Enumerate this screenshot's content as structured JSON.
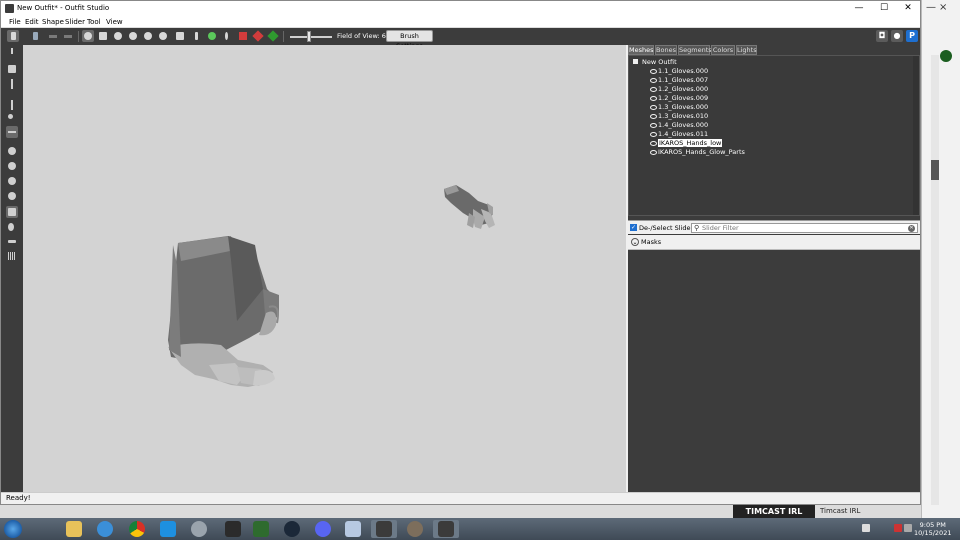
{
  "window": {
    "title": "New Outfit* - Outfit Studio",
    "controls": [
      "—",
      "☐",
      "✕"
    ]
  },
  "menu": [
    "File",
    "Edit",
    "Shape",
    "Slider",
    "Tool",
    "View"
  ],
  "toolbar": {
    "field_of_view_label": "Field of View: 65",
    "brush_settings_label": "Brush Settings",
    "icons": [
      "select-icon",
      "transform-icon",
      "undo-icon",
      "redo-icon",
      "brush-standard-icon",
      "brush-deflate-icon",
      "brush-move-icon",
      "brush-smooth-icon",
      "brush-undiff-icon",
      "brush-weight-icon",
      "brush-color-icon",
      "brush-alpha-icon",
      "eraser-icon",
      "pen-icon",
      "mask-icon",
      "invert-icon",
      "warning-icon",
      "center-icon"
    ],
    "right_icons": [
      "discord-icon",
      "github-icon",
      "patreon-icon"
    ]
  },
  "left_tools": [
    "select-tool-icon",
    "transform-tool-icon",
    "pivot-tool-icon",
    "vertex-tool-icon",
    "mask-brush-icon",
    "inflate-brush-icon",
    "deflate-brush-icon",
    "smooth-brush-icon",
    "move-brush-icon",
    "weight-brush-icon",
    "color-brush-icon",
    "alpha-brush-icon",
    "collision-icon",
    "bone-icon",
    "grid-icon"
  ],
  "tabs": [
    "Meshes",
    "Bones",
    "Segments",
    "Colors",
    "Lights"
  ],
  "mesh_tree": {
    "root": "New Outfit",
    "meshes": [
      "1.1_Gloves.000",
      "1.1_Gloves.007",
      "1.2_Gloves.000",
      "1.2_Gloves.009",
      "1.3_Gloves.000",
      "1.3_Gloves.010",
      "1.4_Gloves.000",
      "1.4_Gloves.011",
      "IKAROS_Hands_low",
      "IKAROS_Hands_Glow_Parts"
    ],
    "selected_index": 8
  },
  "sliders": {
    "deselect_label": "De-/Select Sliders",
    "filter_placeholder": "Slider Filter",
    "masks_label": "Masks"
  },
  "status": {
    "text": "Ready!"
  },
  "taskbar": {
    "apps": [
      "explorer-icon",
      "ie-icon",
      "chrome-icon",
      "app-icon",
      "photos-icon",
      "cursor-icon",
      "terminal-icon",
      "steam-icon",
      "discord-icon",
      "notepad-icon",
      "outfit-studio-icon",
      "skyrim-icon",
      "outfit-studio-icon-2"
    ],
    "time": "9:05 PM",
    "date": "10/15/2021"
  },
  "background": {
    "banner_text": "TIMCAST IRL",
    "banner_caption": "Timcast IRL"
  },
  "colors": {
    "toolbar_dark": "#3c3c3c",
    "viewport": "#d3d3d3",
    "selected_highlight": "#ffffff"
  }
}
